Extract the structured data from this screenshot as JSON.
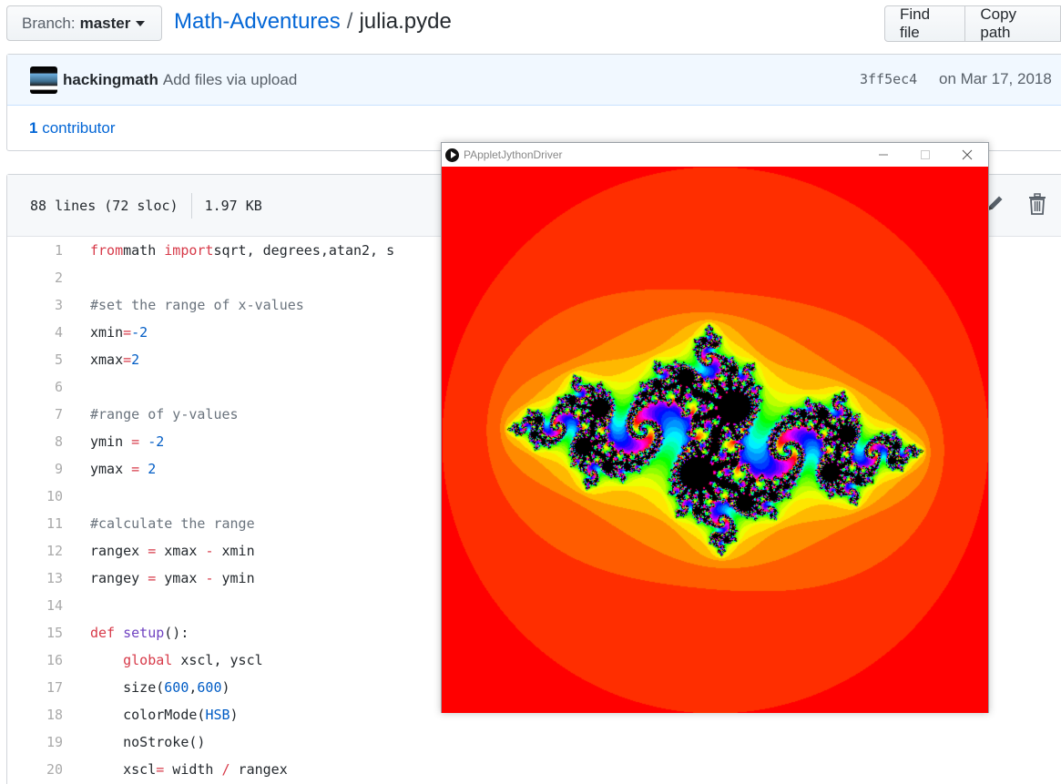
{
  "repo_header": {
    "branch_label": "Branch:",
    "branch_value": "master",
    "repo_name": "Math-Adventures",
    "separator": "/",
    "file_name": "julia.pyde",
    "find_file_label": "Find file",
    "copy_path_label": "Copy path"
  },
  "commit": {
    "author": "hackingmath",
    "message": "Add files via upload",
    "sha": "3ff5ec4",
    "date": "on Mar 17, 2018",
    "contributors_count": "1",
    "contributors_label": "contributor"
  },
  "file_info": {
    "lines": "88 lines (72 sloc)",
    "size": "1.97 KB",
    "actions": [
      "pencil-icon",
      "trash-icon"
    ]
  },
  "code_lines": [
    {
      "n": "1",
      "tokens": [
        [
          "k",
          "from"
        ],
        [
          "",
          "math "
        ],
        [
          "k",
          "import"
        ],
        [
          "",
          "sqrt, degrees,atan2, s"
        ]
      ]
    },
    {
      "n": "2",
      "tokens": []
    },
    {
      "n": "3",
      "tokens": [
        [
          "c",
          "#set the range of x-values"
        ]
      ]
    },
    {
      "n": "4",
      "tokens": [
        [
          "",
          "xmin"
        ],
        [
          "k",
          "="
        ],
        [
          "n",
          "-2"
        ]
      ]
    },
    {
      "n": "5",
      "tokens": [
        [
          "",
          "xmax"
        ],
        [
          "k",
          "="
        ],
        [
          "n",
          "2"
        ]
      ]
    },
    {
      "n": "6",
      "tokens": []
    },
    {
      "n": "7",
      "tokens": [
        [
          "c",
          "#range of y-values"
        ]
      ]
    },
    {
      "n": "8",
      "tokens": [
        [
          "",
          "ymin "
        ],
        [
          "k",
          "="
        ],
        [
          "n",
          " -2"
        ]
      ]
    },
    {
      "n": "9",
      "tokens": [
        [
          "",
          "ymax "
        ],
        [
          "k",
          "="
        ],
        [
          "n",
          " 2"
        ]
      ]
    },
    {
      "n": "10",
      "tokens": []
    },
    {
      "n": "11",
      "tokens": [
        [
          "c",
          "#calculate the range"
        ]
      ]
    },
    {
      "n": "12",
      "tokens": [
        [
          "",
          "rangex "
        ],
        [
          "k",
          "="
        ],
        [
          "",
          " xmax "
        ],
        [
          "k",
          "-"
        ],
        [
          "",
          " xmin"
        ]
      ]
    },
    {
      "n": "13",
      "tokens": [
        [
          "",
          "rangey "
        ],
        [
          "k",
          "="
        ],
        [
          "",
          " ymax "
        ],
        [
          "k",
          "-"
        ],
        [
          "",
          " ymin"
        ]
      ]
    },
    {
      "n": "14",
      "tokens": []
    },
    {
      "n": "15",
      "tokens": [
        [
          "k",
          "def"
        ],
        [
          "",
          " "
        ],
        [
          "f",
          "setup"
        ],
        [
          "",
          "():"
        ]
      ]
    },
    {
      "n": "16",
      "tokens": [
        [
          "",
          "    "
        ],
        [
          "k",
          "global"
        ],
        [
          "",
          " xscl, yscl"
        ]
      ]
    },
    {
      "n": "17",
      "tokens": [
        [
          "",
          "    size("
        ],
        [
          "n",
          "600"
        ],
        [
          "",
          ","
        ],
        [
          "n",
          "600"
        ],
        [
          "",
          ")"
        ]
      ]
    },
    {
      "n": "18",
      "tokens": [
        [
          "",
          "    colorMode("
        ],
        [
          "n",
          "HSB"
        ],
        [
          "",
          ")"
        ]
      ]
    },
    {
      "n": "19",
      "tokens": [
        [
          "",
          "    noStroke()"
        ]
      ]
    },
    {
      "n": "20",
      "tokens": [
        [
          "",
          "    xscl"
        ],
        [
          "k",
          "="
        ],
        [
          "",
          " width "
        ],
        [
          "k",
          "/"
        ],
        [
          "",
          " rangex"
        ]
      ]
    }
  ],
  "sketch_window": {
    "title": "PAppletJythonDriver",
    "controls": [
      "minimize",
      "maximize",
      "close"
    ]
  },
  "colors": {
    "link": "#0366d6",
    "keyword": "#d73a49",
    "number": "#005cc5",
    "comment": "#6a737d",
    "function": "#6f42c1",
    "commit_bg": "#f1f8ff"
  }
}
